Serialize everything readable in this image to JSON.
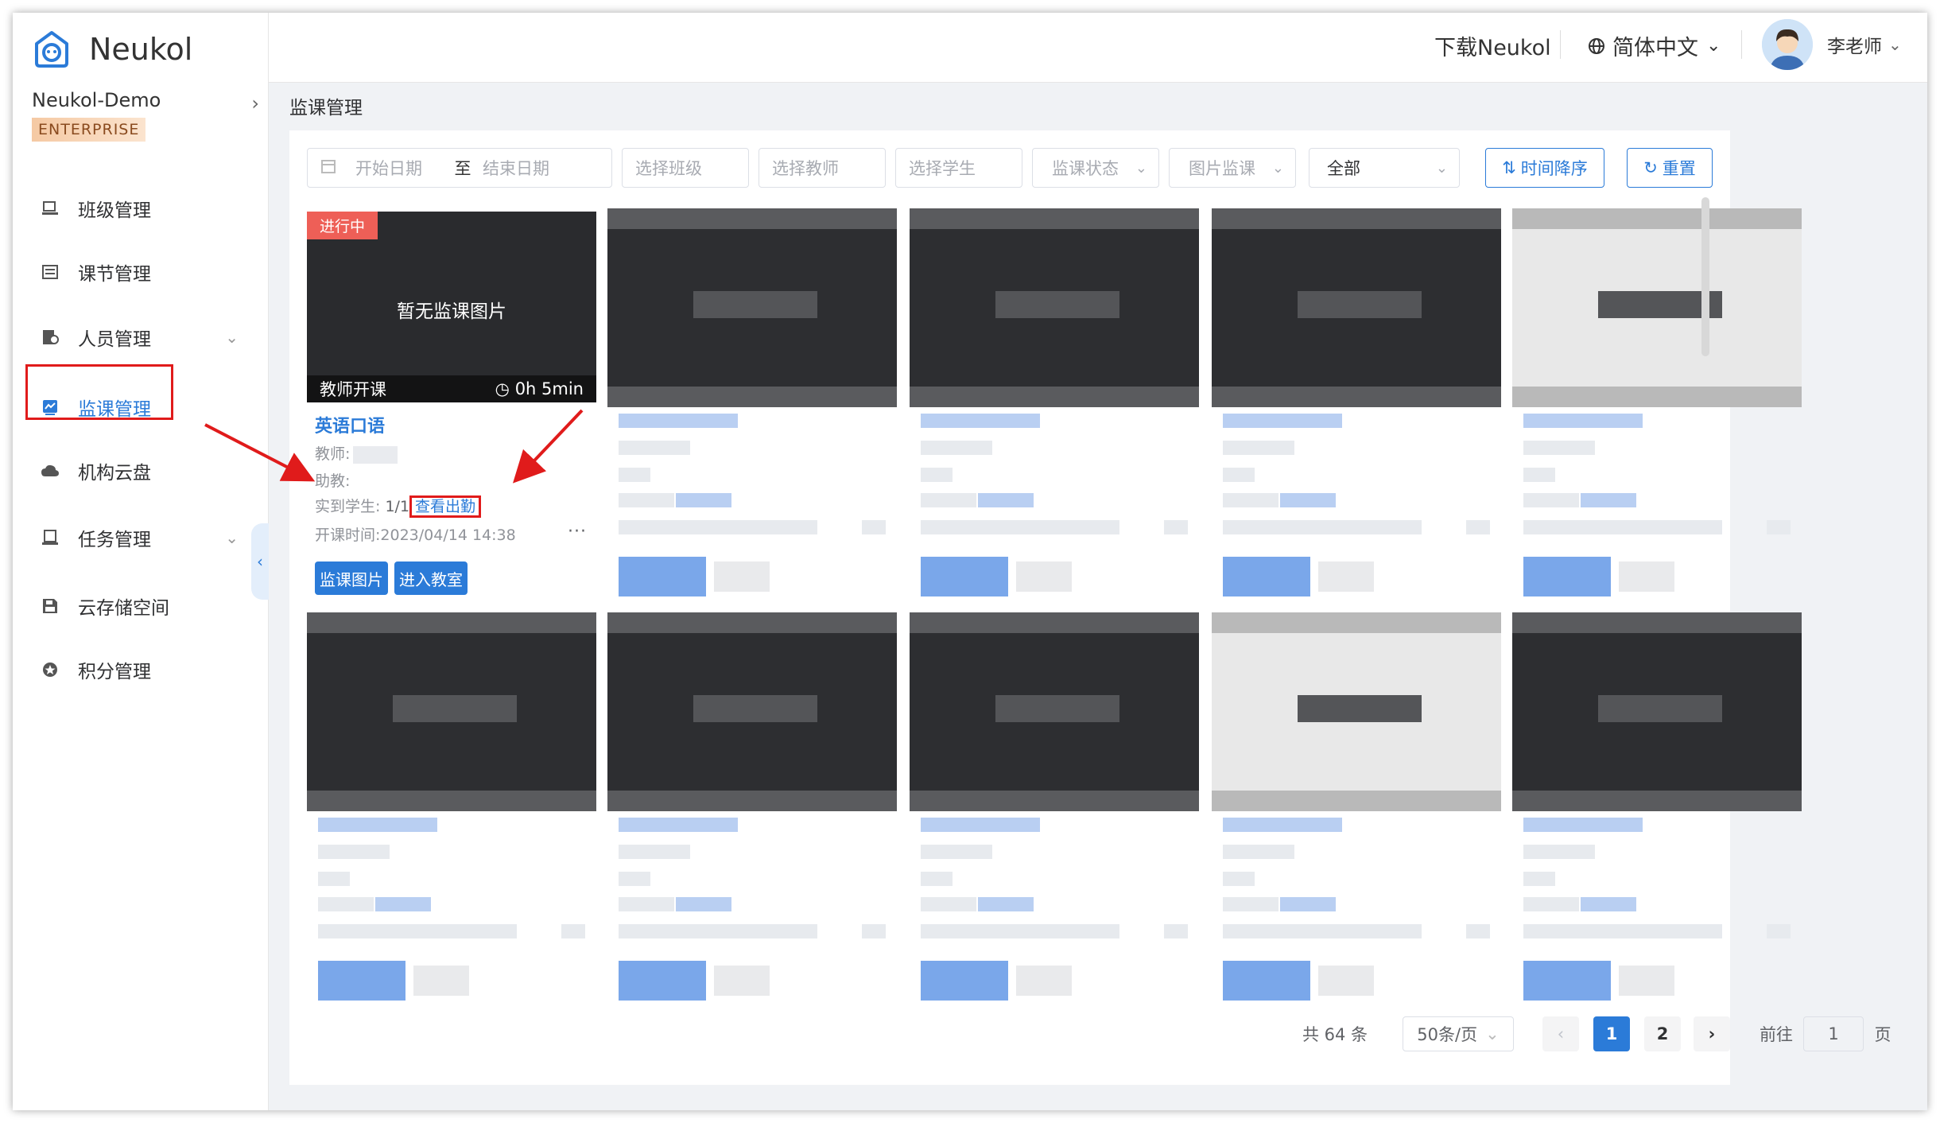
{
  "app": {
    "name": "Neukol"
  },
  "org": {
    "name": "Neukol-Demo",
    "plan": "ENTERPRISE"
  },
  "sidebar": {
    "items": [
      {
        "label": "班级管理",
        "icon": "class-icon"
      },
      {
        "label": "课节管理",
        "icon": "lesson-icon"
      },
      {
        "label": "人员管理",
        "icon": "people-icon",
        "expandable": true
      },
      {
        "label": "监课管理",
        "icon": "monitor-icon",
        "active": true
      },
      {
        "label": "机构云盘",
        "icon": "cloud-icon"
      },
      {
        "label": "任务管理",
        "icon": "task-icon",
        "expandable": true
      },
      {
        "label": "云存储空间",
        "icon": "storage-icon"
      },
      {
        "label": "积分管理",
        "icon": "points-icon"
      }
    ]
  },
  "header": {
    "download": "下载Neukol",
    "language": "简体中文",
    "user": "李老师"
  },
  "breadcrumb": "监课管理",
  "filters": {
    "start_date": "开始日期",
    "to": "至",
    "end_date": "结束日期",
    "class": "选择班级",
    "teacher": "选择教师",
    "student": "选择学生",
    "status": "监课状态",
    "image_monitor": "图片监课",
    "scope": "全部",
    "sort_button": "时间降序",
    "reset_button": "重置"
  },
  "first_card": {
    "status_tag": "进行中",
    "no_image": "暂无监课图片",
    "started_by": "教师开课",
    "duration": "0h 5min",
    "title": "英语口语",
    "teacher_label": "教师:",
    "assistant_label": "助教:",
    "students_label": "实到学生:",
    "students_value": "1/1",
    "attendance_link": "查看出勤",
    "time_label": "开课时间:",
    "time_value": "2023/04/14 14:38",
    "more": "···",
    "btn_images": "监课图片",
    "btn_enter": "进入教室"
  },
  "pagination": {
    "total": "共 64 条",
    "page_size": "50条/页",
    "pages": [
      "1",
      "2"
    ],
    "current": "1",
    "goto_label": "前往",
    "goto_value": "1",
    "page_suffix": "页"
  },
  "colors": {
    "accent": "#2b7bd8",
    "annotation": "#e01b1b",
    "tag": "#ee5f57"
  }
}
